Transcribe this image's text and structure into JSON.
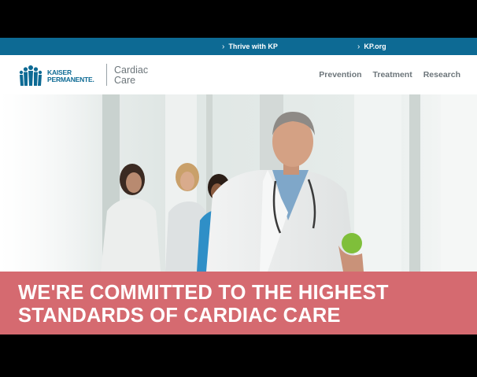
{
  "utility_nav": {
    "links": [
      {
        "label": "Thrive with KP"
      },
      {
        "label": "KP.org"
      }
    ]
  },
  "logo": {
    "line1": "KAISER",
    "line2": "PERMANENTE."
  },
  "product": {
    "name_line1": "Cardiac",
    "name_line2": "Care"
  },
  "main_nav": {
    "items": [
      {
        "label": "Prevention"
      },
      {
        "label": "Treatment"
      },
      {
        "label": "Research"
      }
    ]
  },
  "hero": {
    "image": "doctor-holding-apple-with-medical-staff"
  },
  "banner": {
    "line1": "WE'RE COMMITTED TO THE HIGHEST",
    "line2": "STANDARDS OF CARDIAC CARE"
  },
  "colors": {
    "utility_bar": "#0d6a94",
    "brand_blue": "#0d6a94",
    "nav_text": "#6c757a",
    "banner": "#d56a70",
    "letterbox": "#000000"
  }
}
